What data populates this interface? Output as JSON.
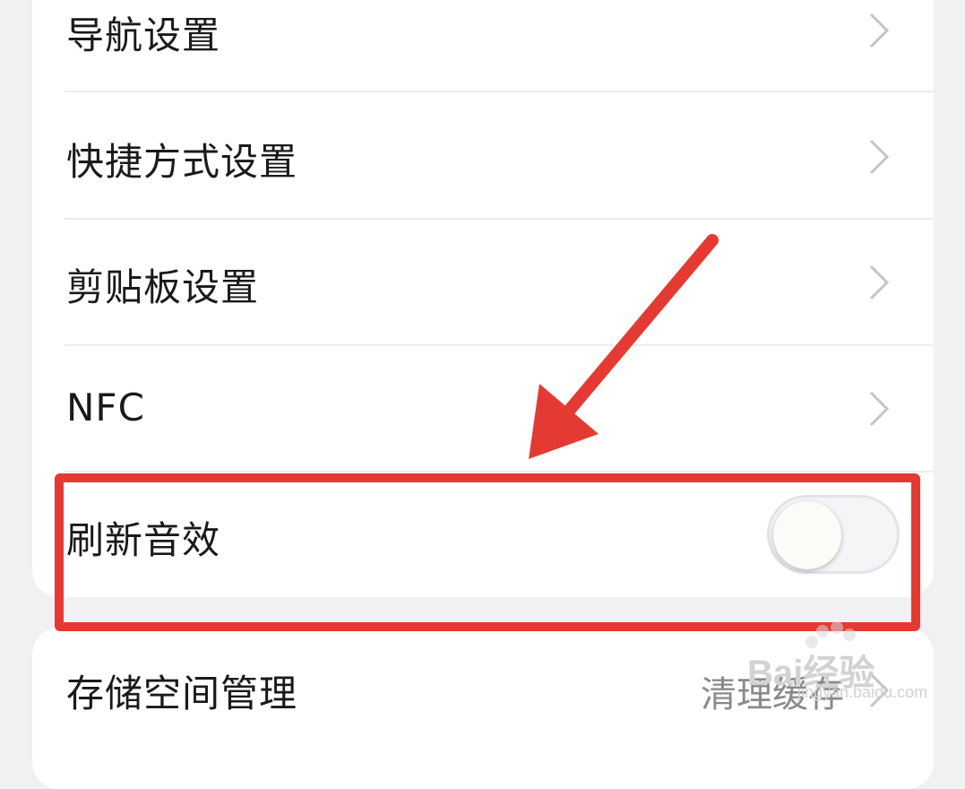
{
  "settings": {
    "items": [
      {
        "label": "导航设置",
        "control": "chevron"
      },
      {
        "label": "快捷方式设置",
        "control": "chevron"
      },
      {
        "label": "剪贴板设置",
        "control": "chevron"
      },
      {
        "label": "NFC",
        "control": "chevron"
      },
      {
        "label": "刷新音效",
        "control": "toggle",
        "toggle_on": false
      }
    ],
    "storage": {
      "label": "存储空间管理",
      "value": "清理缓存"
    }
  },
  "annotation": {
    "highlight_color": "#e53a33",
    "arrow_color": "#e53a33"
  },
  "watermark": {
    "text": "Bai经验",
    "sub": "jingyan.baidu.com"
  }
}
